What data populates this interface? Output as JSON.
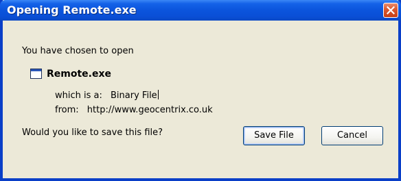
{
  "window": {
    "title": "Opening Remote.exe"
  },
  "dialog": {
    "intro": "You have chosen to open",
    "file_name": "Remote.exe",
    "type_label": "which is a:",
    "type_value": "Binary File",
    "from_label": "from:",
    "from_value": "http://www.geocentrix.co.uk",
    "question": "Would you like to save this file?"
  },
  "buttons": {
    "save_label": "Save File",
    "cancel_label": "Cancel"
  },
  "icons": {
    "close": "close-icon",
    "file": "application-window-icon"
  },
  "colors": {
    "titlebar": "#0b54dc",
    "close_button": "#dc5a31",
    "dialog_background": "#ece9d8"
  }
}
